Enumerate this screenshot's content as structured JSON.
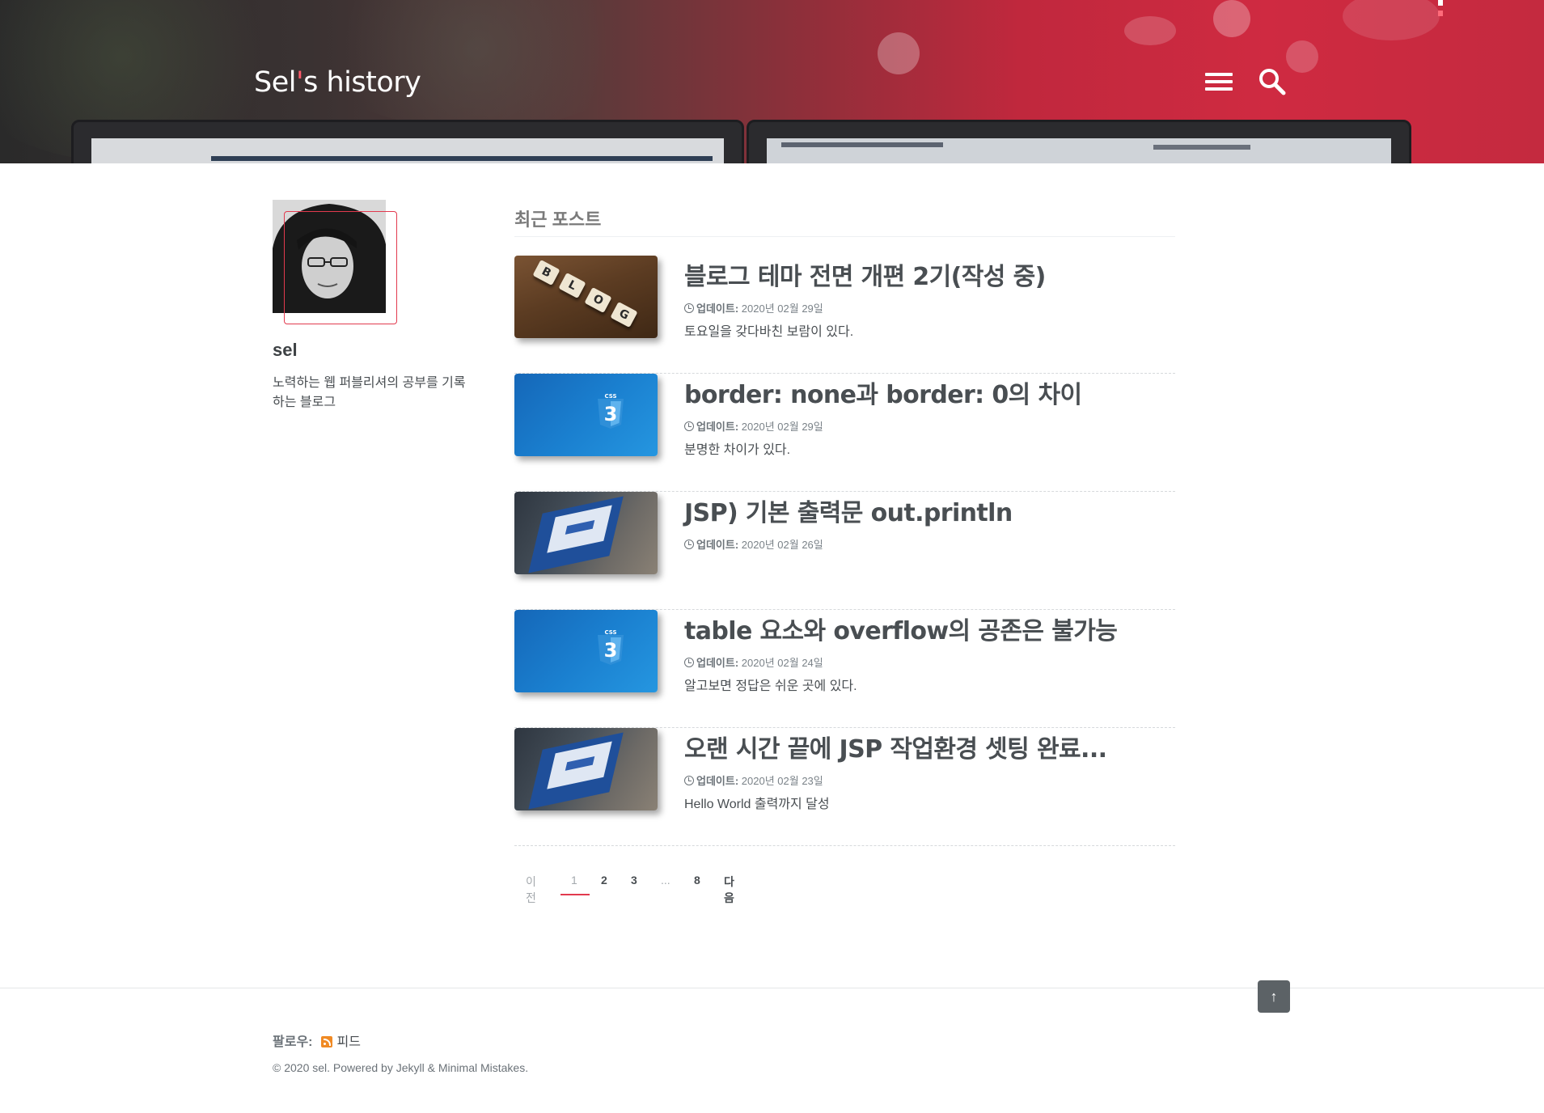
{
  "header": {
    "site_title_prefix": "Sel",
    "site_title_tick": "'",
    "site_title_suffix": "s history",
    "menu_icon": "hamburger-menu-icon",
    "search_icon": "search-icon"
  },
  "sidebar": {
    "author_name": "sel",
    "author_bio": "노력하는 웹 퍼블리셔의 공부를 기록하는 블로그"
  },
  "main": {
    "section_title": "최근 포스트",
    "meta_label": "업데이트:",
    "posts": [
      {
        "title": "블로그 테마 전면 개편 2기(작성 중)",
        "date": "2020년 02월 29일",
        "excerpt": "토요일을 갖다바친 보람이 있다.",
        "thumbnail": "blog-tiles"
      },
      {
        "title": "border: none과 border: 0의 차이",
        "date": "2020년 02월 29일",
        "excerpt": "분명한 차이가 있다.",
        "thumbnail": "css3-logo"
      },
      {
        "title": "JSP) 기본 출력문 out.println",
        "date": "2020년 02월 26일",
        "excerpt": "",
        "thumbnail": "laptop-screen"
      },
      {
        "title": "table 요소와 overflow의 공존은 불가능",
        "date": "2020년 02월 24일",
        "excerpt": "알고보면 정답은 쉬운 곳에 있다.",
        "thumbnail": "css3-logo"
      },
      {
        "title": "오랜 시간 끝에 JSP 작업환경 셋팅 완료...",
        "date": "2020년 02월 23일",
        "excerpt": "Hello World 출력까지 달성",
        "thumbnail": "laptop-screen"
      }
    ]
  },
  "pagination": {
    "prev": "이전",
    "pages": [
      "1",
      "2",
      "3",
      "...",
      "8"
    ],
    "current": "1",
    "next": "다음"
  },
  "footer": {
    "back_to_top": "↑",
    "follow_label": "팔로우:",
    "feed_label": "피드",
    "copyright": "© 2020 sel. Powered by Jekyll & Minimal Mistakes."
  },
  "colors": {
    "accent": "#e23a4e",
    "text": "#494e52",
    "rss": "#f08a24"
  }
}
